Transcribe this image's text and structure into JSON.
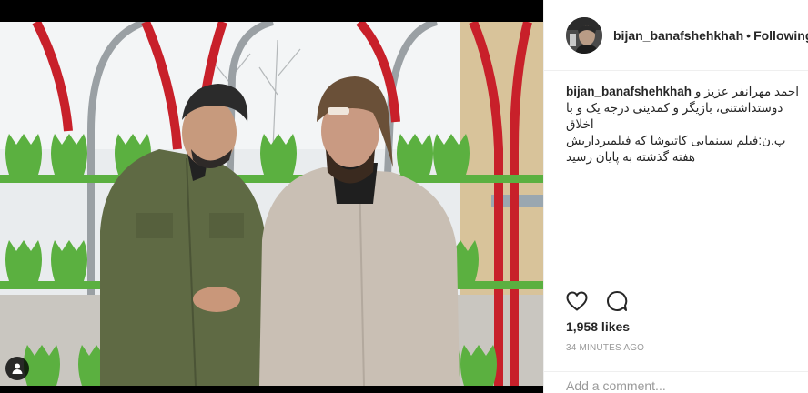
{
  "post": {
    "image_alt": "Two men in coats standing in front of a red and green decorative structure"
  },
  "header": {
    "username": "bijan_banafshehkhah",
    "separator": "•",
    "follow_label": "Following"
  },
  "caption": {
    "username": "bijan_banafshehkhah",
    "lines": [
      "احمد مهرانفر عزیز و",
      "دوستداشتنی، بازیگر و کمدینی درجه یک و با",
      "اخلاق",
      "پ.ن:فیلم سینمایی کاتیوشا که فیلمبرداریش",
      "هفته گذشته به پایان رسید"
    ]
  },
  "actions": {
    "like_icon": "heart-icon",
    "comment_icon": "comment-icon",
    "likes_text": "1,958 likes",
    "timestamp": "34 MINUTES AGO"
  },
  "comment_box": {
    "placeholder": "Add a comment..."
  },
  "colors": {
    "accent_red": "#c8202a",
    "leaf_green": "#5bb040",
    "border": "#efefef",
    "muted_text": "#999999"
  }
}
